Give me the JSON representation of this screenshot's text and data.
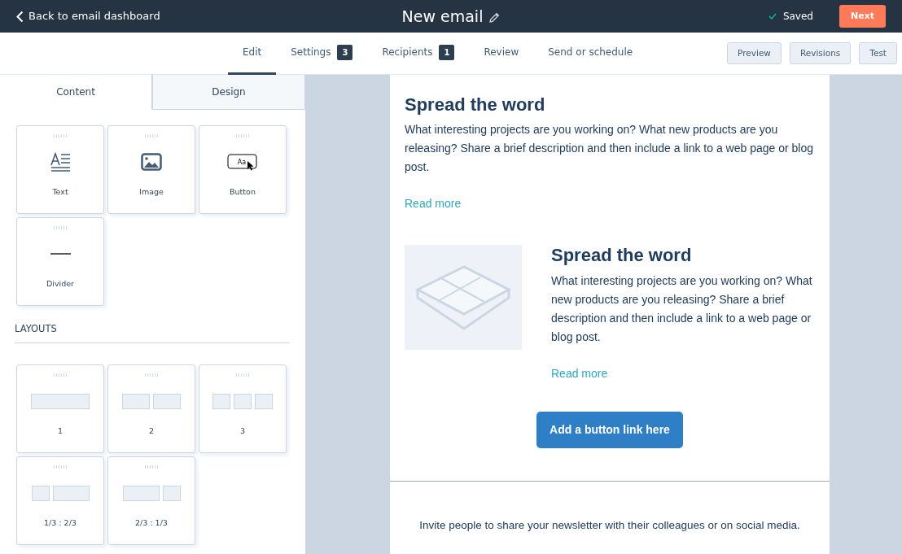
{
  "header": {
    "back": "Back to email dashboard",
    "title": "New email",
    "saved": "Saved",
    "next": "Next"
  },
  "nav_tabs": [
    {
      "label": "Edit",
      "selected": true
    },
    {
      "label": "Settings",
      "count": "3",
      "selected": false
    },
    {
      "label": "Recipients",
      "count": "1",
      "selected": false
    },
    {
      "label": "Review",
      "selected": false
    },
    {
      "label": "Send or schedule",
      "selected": false
    }
  ],
  "actions": [
    "Preview",
    "Revisions",
    "Test"
  ],
  "panel_tabs": [
    {
      "label": "Content",
      "selected": true
    },
    {
      "label": "Design",
      "selected": false
    }
  ],
  "modules": [
    {
      "label": "Text",
      "kind": "text"
    },
    {
      "label": "Image",
      "kind": "image"
    },
    {
      "label": "Button",
      "kind": "button",
      "icon_text": "Aa"
    },
    {
      "label": "Divider",
      "kind": "divider"
    }
  ],
  "layouts_heading": "LAYOUTS",
  "layouts": [
    {
      "label": "1",
      "kind": "full"
    },
    {
      "label": "2",
      "kind": "halves"
    },
    {
      "label": "3",
      "kind": "thirds"
    },
    {
      "label": "1/3 : 2/3",
      "kind": "third-left"
    },
    {
      "label": "2/3 : 1/3",
      "kind": "third-right"
    }
  ],
  "email": {
    "section1": {
      "heading": "Spread the word",
      "body": "What interesting projects are you working on? What new products are you releasing? Share a brief description and then include a link to a web page or blog post.",
      "link": "Read more"
    },
    "section2": {
      "heading": "Spread the word",
      "body": "What interesting projects are you working on? What new products are you releasing? Share a brief description and then include a link to a web page or blog post.",
      "link": "Read more"
    },
    "cta": "Add a button link here",
    "footer": "Invite people to share your newsletter with their colleagues or on social media."
  }
}
